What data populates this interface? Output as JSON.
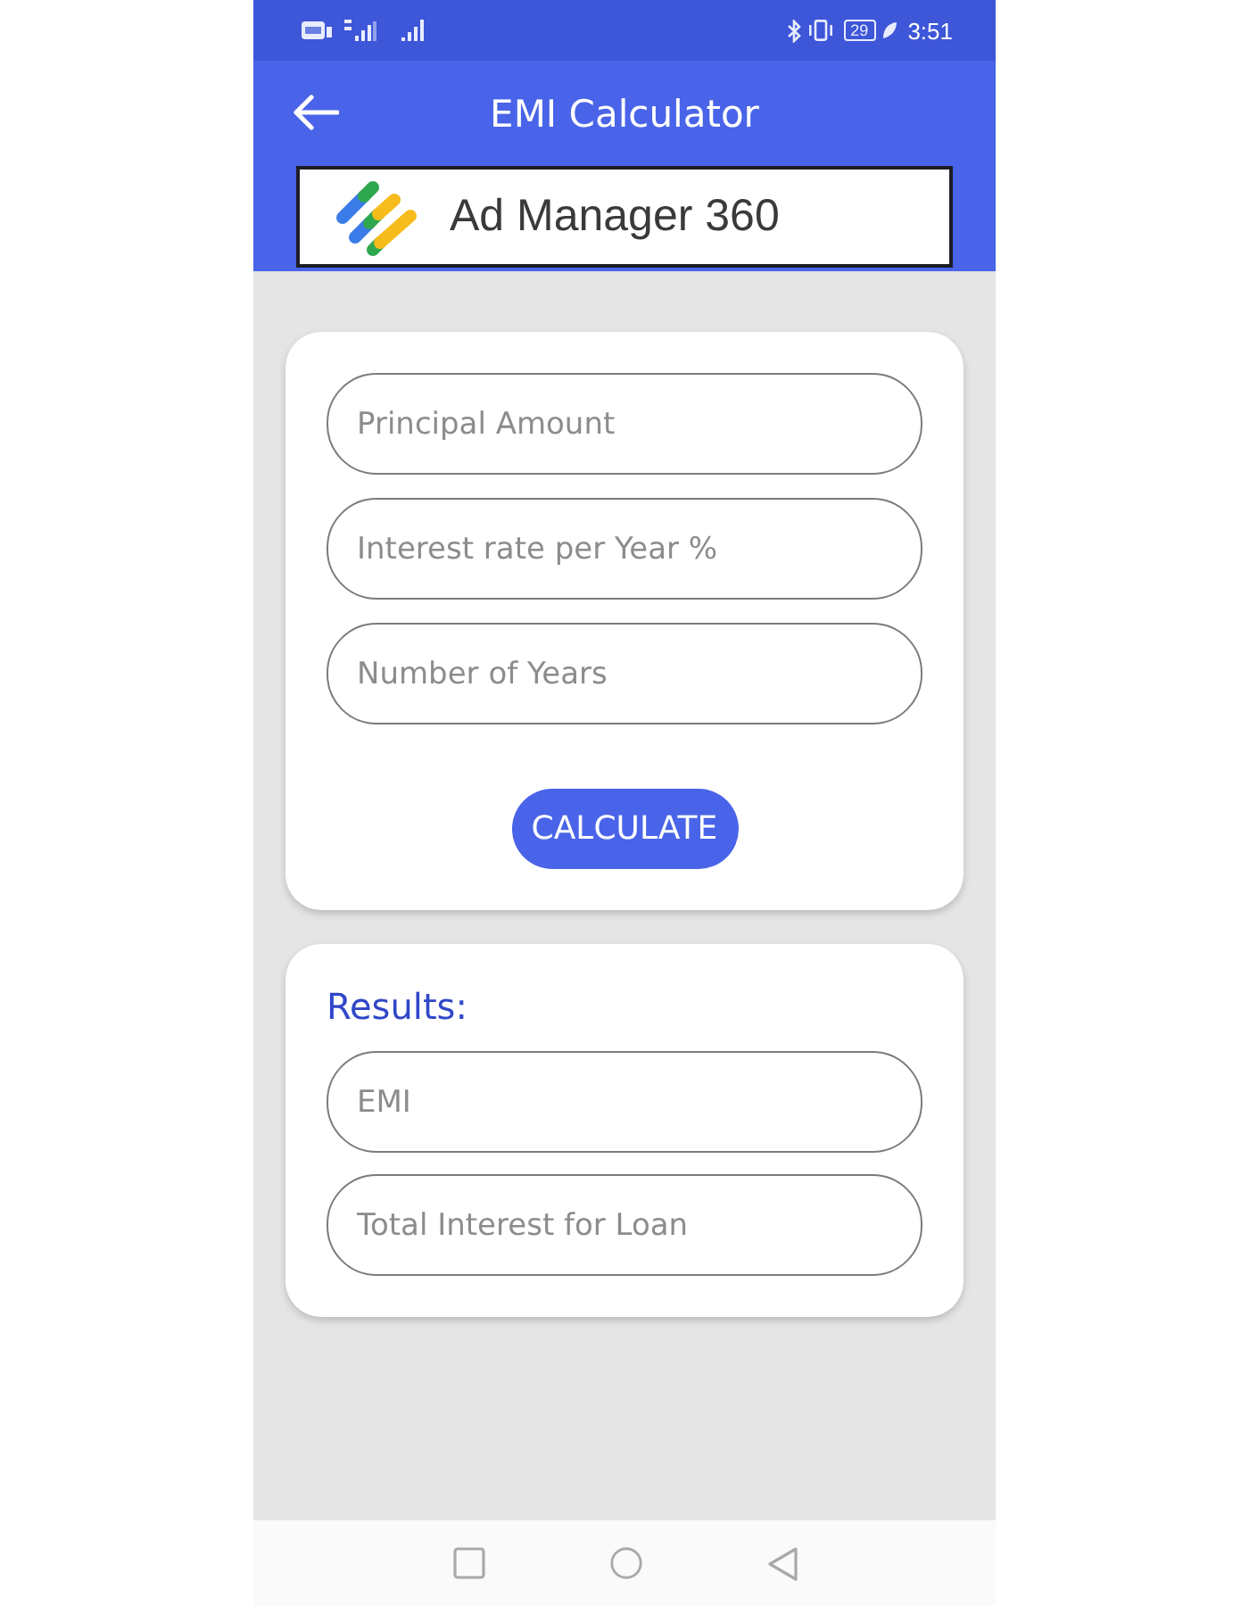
{
  "status_bar": {
    "battery": "29",
    "time": "3:51"
  },
  "app_bar": {
    "title": "EMI Calculator"
  },
  "ad_banner": {
    "text": "Ad Manager 360"
  },
  "input_card": {
    "fields": [
      {
        "placeholder": "Principal Amount"
      },
      {
        "placeholder": "Interest rate per Year %"
      },
      {
        "placeholder": "Number of Years"
      }
    ],
    "button": "CALCULATE"
  },
  "results_card": {
    "title": "Results:",
    "fields": [
      {
        "placeholder": "EMI"
      },
      {
        "placeholder": "Total Interest for Loan"
      }
    ]
  }
}
